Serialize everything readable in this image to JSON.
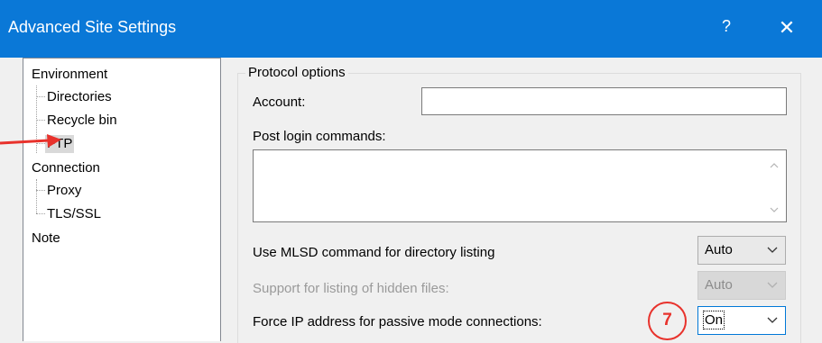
{
  "window": {
    "title": "Advanced Site Settings",
    "help": "?",
    "close": "✕"
  },
  "tree": {
    "items": [
      {
        "label": "Environment"
      },
      {
        "label": "Directories"
      },
      {
        "label": "Recycle bin"
      },
      {
        "label": "FTP"
      },
      {
        "label": "Connection"
      },
      {
        "label": "Proxy"
      },
      {
        "label": "TLS/SSL"
      },
      {
        "label": "Note"
      }
    ],
    "selected": "FTP"
  },
  "protocol": {
    "group_title": "Protocol options",
    "account_label": "Account:",
    "account_value": "",
    "post_login_label": "Post login commands:",
    "post_login_value": "",
    "mlsd_label": "Use MLSD command for directory listing",
    "mlsd_value": "Auto",
    "hidden_label": "Support for listing of hidden files:",
    "hidden_value": "Auto",
    "force_ip_label": "Force IP address for passive mode connections:",
    "force_ip_value": "On"
  },
  "annotation": {
    "step": "7",
    "color": "#e8322c"
  },
  "colors": {
    "titlebar": "#0a78d7",
    "window_bg": "#f0f0f0",
    "focus": "#0078d7"
  }
}
